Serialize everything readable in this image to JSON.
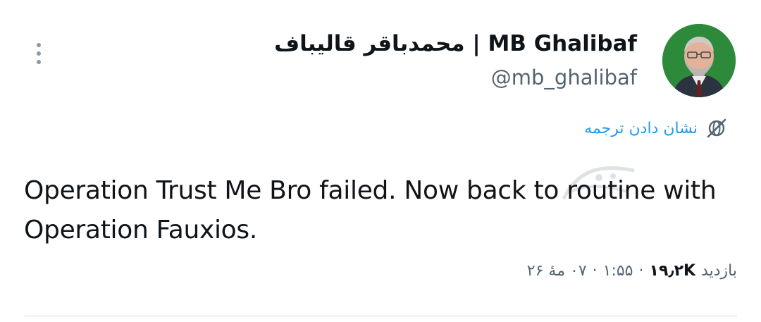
{
  "tweet": {
    "author": {
      "display_name": "محمدباقر قالیباف | MB Ghalibaf",
      "handle": "@mb_ghalibaf",
      "avatar_icon": "avatar-portrait-icon"
    },
    "translate": {
      "label": "نشان دادن ترجمه",
      "icon": "translate-globe-icon"
    },
    "text": "Operation Trust Me Bro failed. Now back to routine with Operation Fauxios.",
    "meta": {
      "views_label": "بازدید",
      "views_count": "۱۹٫۲K",
      "separator": "·",
      "time": "۱:۵۵",
      "date": "۰۷ مهٔ ۲۶"
    },
    "more_icon": "more-vertical-icon"
  },
  "colors": {
    "text_primary": "#0f1419",
    "text_secondary": "#536471",
    "link_blue": "#1d9bf0",
    "divider": "#cfd9de",
    "avatar_bg": "#2c8a3a"
  }
}
